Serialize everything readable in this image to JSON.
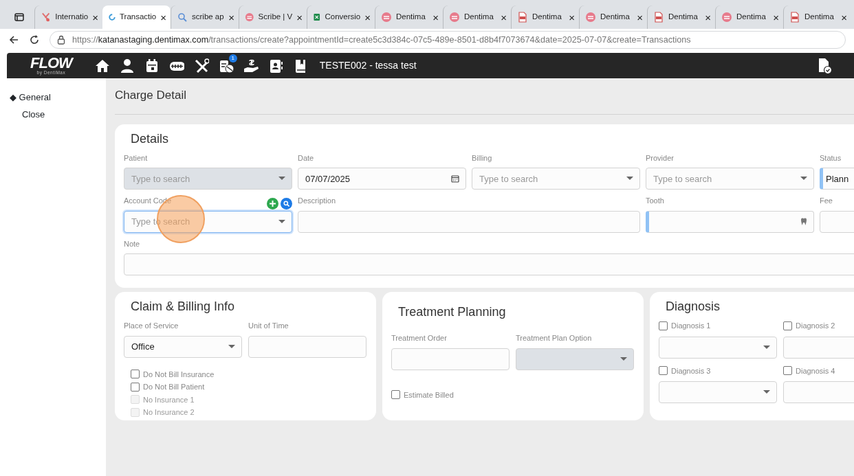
{
  "browser": {
    "tabs": [
      {
        "kind": "puzzle",
        "title": "Internatio",
        "selected": false
      },
      {
        "kind": "spinner",
        "title": "Transactio",
        "selected": true
      },
      {
        "kind": "search",
        "title": "scribe ap",
        "selected": false
      },
      {
        "kind": "scribe",
        "title": "Scribe | V",
        "selected": false
      },
      {
        "kind": "sheet",
        "title": "Conversio",
        "selected": false
      },
      {
        "kind": "scribe",
        "title": "Dentima",
        "selected": false
      },
      {
        "kind": "scribe",
        "title": "Dentima",
        "selected": false
      },
      {
        "kind": "pdf",
        "title": "Dentima",
        "selected": false
      },
      {
        "kind": "scribe",
        "title": "Dentima",
        "selected": false
      },
      {
        "kind": "pdf",
        "title": "Dentima",
        "selected": false
      },
      {
        "kind": "scribe",
        "title": "Dentima",
        "selected": false
      },
      {
        "kind": "pdf",
        "title": "Dentima",
        "selected": false
      }
    ],
    "close_glyph": "×",
    "url": {
      "scheme": "https://",
      "host": "katanastaging.dentimax.com",
      "path": "/transactions/create?appointmentId=create5c3d384c-07c5-489e-8501-d8b4f7073674&date=2025-07-07&create=Transactions"
    }
  },
  "app": {
    "logo": "FLOW",
    "logo_sub": "by DentiMax",
    "nav_icons": [
      {
        "kind": "home"
      },
      {
        "kind": "person"
      },
      {
        "kind": "calendar"
      },
      {
        "kind": "teeth"
      },
      {
        "kind": "tools"
      },
      {
        "kind": "pills",
        "badge": "1"
      },
      {
        "kind": "hand"
      },
      {
        "kind": "contact"
      },
      {
        "kind": "book"
      }
    ],
    "patient": "TESTE002 - tessa test"
  },
  "sidebar": {
    "items": [
      {
        "marker": "◆",
        "label": "General"
      },
      {
        "label": "Close"
      }
    ]
  },
  "page_title": "Charge Detail",
  "details": {
    "title": "Details",
    "fields": [
      {
        "label": "Patient",
        "kind": "select",
        "placeholder": "Type to search",
        "disabled": true,
        "focused": false,
        "marked": false
      },
      {
        "label": "Date",
        "kind": "date",
        "value": "07/07/2025",
        "disabled": false,
        "focused": false,
        "marked": false
      },
      {
        "label": "Billing",
        "kind": "select",
        "placeholder": "Type to search",
        "disabled": false,
        "focused": false,
        "marked": false
      },
      {
        "label": "Provider",
        "kind": "select",
        "placeholder": "Type to search",
        "disabled": false,
        "focused": false,
        "marked": false
      },
      {
        "label": "Status",
        "kind": "text",
        "value": "Plann",
        "disabled": false,
        "focused": false,
        "marked": true
      },
      {
        "label": "Account Code",
        "kind": "select",
        "placeholder": "Type to search",
        "disabled": false,
        "focused": true,
        "marked": false,
        "buttons": [
          {
            "kind": "add"
          },
          {
            "kind": "search"
          }
        ]
      },
      {
        "label": "Description",
        "kind": "wide-text",
        "disabled": false,
        "focused": false,
        "marked": false
      },
      {
        "label": "Tooth",
        "kind": "tooth",
        "disabled": false,
        "focused": false,
        "marked": true
      },
      {
        "label": "Fee",
        "kind": "text",
        "disabled": false,
        "focused": false,
        "marked": false
      },
      {
        "label": "Note",
        "kind": "note",
        "disabled": false,
        "focused": false,
        "marked": false
      }
    ]
  },
  "claim": {
    "title": "Claim & Billing Info",
    "fields": [
      {
        "label": "Place of Service",
        "kind": "select",
        "value": "Office",
        "disabled": false,
        "focused": false,
        "marked": false
      },
      {
        "label": "Unit of Time",
        "kind": "text",
        "disabled": false,
        "focused": false,
        "marked": false
      }
    ],
    "checks": [
      {
        "label": "Do Not Bill Insurance",
        "checked": false,
        "disabled": false
      },
      {
        "label": "Do Not Bill Patient",
        "checked": false,
        "disabled": false
      },
      {
        "label": "No Insurance 1",
        "checked": false,
        "disabled": true
      },
      {
        "label": "No Insurance 2",
        "checked": false,
        "disabled": true
      }
    ]
  },
  "treatment": {
    "title": "Treatment Planning",
    "fields": [
      {
        "label": "Treatment Order",
        "kind": "text",
        "disabled": false,
        "focused": false,
        "marked": false
      },
      {
        "label": "Treatment Plan Option",
        "kind": "select",
        "disabled": true,
        "focused": false,
        "marked": false
      }
    ],
    "checks": [
      {
        "label": "Estimate Billed",
        "checked": false,
        "disabled": false
      }
    ]
  },
  "diagnosis": {
    "title": "Diagnosis",
    "items": [
      {
        "label": "Diagnosis 1",
        "checked": false
      },
      {
        "label": "Diagnosis 2",
        "checked": false
      },
      {
        "label": "Diagnosis 3",
        "checked": false
      },
      {
        "label": "Diagnosis 4",
        "checked": false
      }
    ]
  }
}
